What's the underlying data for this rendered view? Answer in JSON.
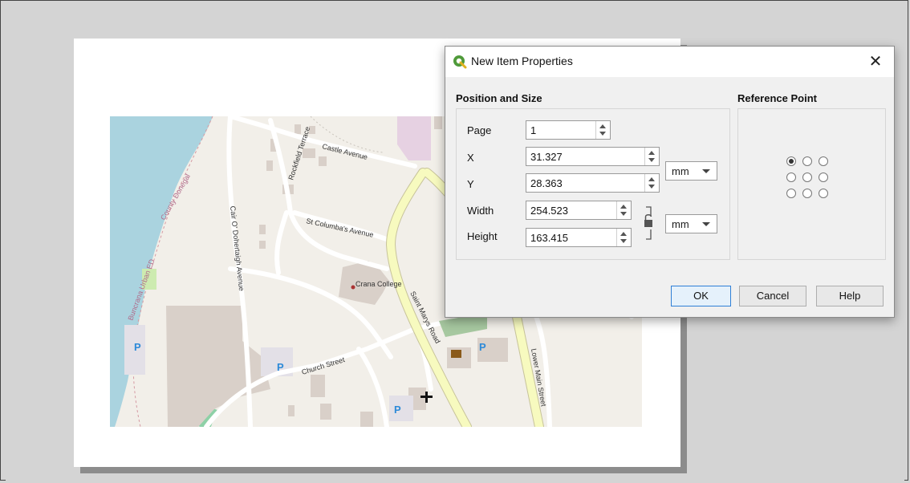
{
  "dialog": {
    "title": "New Item Properties",
    "close_glyph": "✕",
    "position_size": {
      "title": "Position and Size",
      "page_label": "Page",
      "page_value": "1",
      "x_label": "X",
      "x_value": "31.327",
      "y_label": "Y",
      "y_value": "28.363",
      "pos_unit": "mm",
      "width_label": "Width",
      "width_value": "254.523",
      "height_label": "Height",
      "height_value": "163.415",
      "size_unit": "mm"
    },
    "reference_point": {
      "title": "Reference Point",
      "selected": "top-left"
    },
    "buttons": {
      "ok": "OK",
      "cancel": "Cancel",
      "help": "Help"
    }
  },
  "map": {
    "labels": {
      "castle_avenue": "Castle Avenue",
      "rockfield_terrace": "Rockfield Terrace",
      "st_columbas": "St Columba's Avenue",
      "cair_o": "Cair O' Dohertaigh Avenue",
      "crana_college": "Crana College",
      "saint_marys": "Saint Marys Road",
      "church_street": "Church Street",
      "lower_main": "Lower Main Street",
      "county_donegal": "County Donegal",
      "buncrana_urban": "Buncrana Urban ED",
      "parking": "P"
    }
  },
  "colors": {
    "water": "#aad3df",
    "land": "#f2efe9",
    "building": "#d9d0c9",
    "primary_road": "#f7fabf",
    "accent": "#2f7fd6"
  }
}
